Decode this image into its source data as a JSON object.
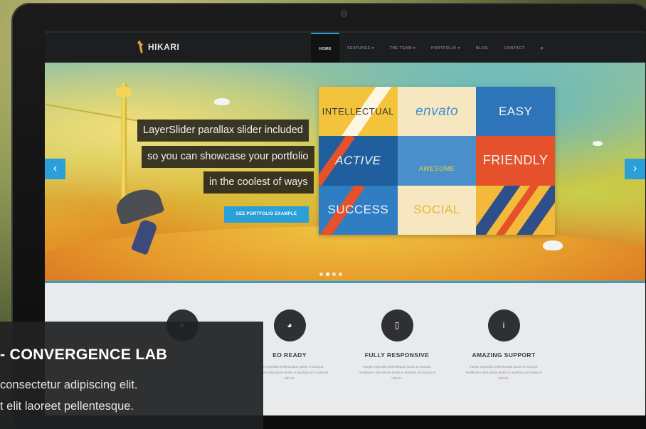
{
  "navbar": {
    "logo_text": "HIKARI",
    "menu": [
      {
        "label": "HOME",
        "active": true
      },
      {
        "label": "FEATURES ▾",
        "active": false
      },
      {
        "label": "THE TEAM ▾",
        "active": false
      },
      {
        "label": "PORTFOLIO ▾",
        "active": false
      },
      {
        "label": "BLOG",
        "active": false
      },
      {
        "label": "CONTACT",
        "active": false
      }
    ],
    "search_icon": "search-icon"
  },
  "hero": {
    "captions": [
      "LayerSlider parallax slider included",
      "so you can showcase your portfolio",
      "in the coolest of ways"
    ],
    "cta_label": "SEE PORTFOLIO EXAMPLE",
    "prev_label": "‹",
    "next_label": "›",
    "dots": 4,
    "active_dot": 1,
    "tiles": [
      {
        "label": "INTELLECTUAL",
        "bg": "#f4c33c",
        "fg": "#3c3a33"
      },
      {
        "label": "envato",
        "bg": "#f7e7c1",
        "fg": "#3f8fd0"
      },
      {
        "label": "EASY",
        "bg": "#2e74b9",
        "fg": "#f2f2f2"
      },
      {
        "label": "ACTIVE",
        "bg": "#1f5f9e",
        "fg": "#f2f2f2"
      },
      {
        "label": "AWESOME",
        "bg": "#4a8fc9",
        "fg": "#f3cf3c"
      },
      {
        "label": "FRIENDLY",
        "bg": "#e4512b",
        "fg": "#f2f2f2"
      },
      {
        "label": "SUCCESS",
        "bg": "#2f7dc2",
        "fg": "#f2f2f2"
      },
      {
        "label": "SOCIAL",
        "bg": "#f7e7c1",
        "fg": "#e6b534"
      },
      {
        "label": "",
        "bg": "#f2b93a",
        "fg": "#2f4f8a"
      }
    ]
  },
  "features": [
    {
      "icon": "star-icon",
      "glyph": "★",
      "title": "",
      "text": ""
    },
    {
      "icon": "palette-icon",
      "glyph": "◕",
      "title": "EO READY",
      "text": "Integer imperdiet pellentesque ipsum et suscipit. Vestibulum ante ipsum primis in faucibus orci luctus et ultrices."
    },
    {
      "icon": "tablet-icon",
      "glyph": "▯",
      "title": "FULLY RESPONSIVE",
      "text": "Integer imperdiet pellentesque ipsum et suscipit. Vestibulum ante ipsum primis in faucibus orci luctus et ultrices."
    },
    {
      "icon": "info-icon",
      "glyph": "i",
      "title": "AMAZING SUPPORT",
      "text": "Integer imperdiet pellentesque ipsum et suscipit. Vestibulum ante ipsum primis in faucibus orci luctus et ultrices."
    }
  ],
  "overlay": {
    "title": "- CONVERGENCE LAB",
    "line1": "consectetur adipiscing elit.",
    "line2": "t elit laoreet pellentesque."
  },
  "colors": {
    "accent": "#2a9fd8",
    "navbar_bg": "#1d1e20",
    "icon_circle": "#2e3033"
  }
}
